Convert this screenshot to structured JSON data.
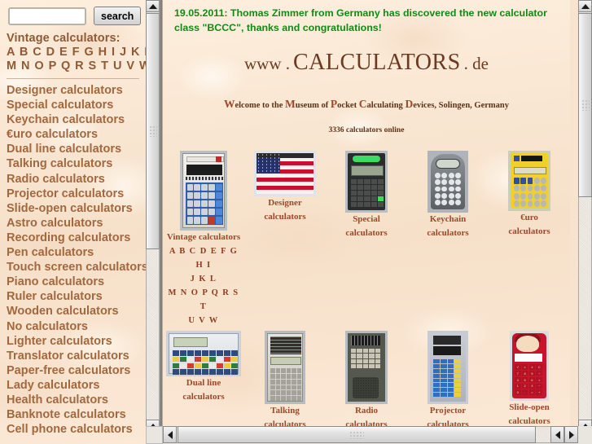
{
  "search": {
    "value": "",
    "placeholder": "",
    "button_label": "search"
  },
  "sidebar": {
    "heading": "Vintage calculators:",
    "alphabet_lines": [
      "A B C D E F G H I J K L",
      "M N O P Q R S T U V W"
    ],
    "items": [
      "Designer calculators",
      "Special calculators",
      "Keychain calculators",
      "€uro calculators",
      "Dual line calculators",
      "Talking calculators",
      "Radio calculators",
      "Projector calculators",
      "Slide-open calculators",
      "Astro calculators",
      "Recording calculators",
      "Pen calculators",
      "Touch screen calculators",
      "Piano calculators",
      "Ruler calculators",
      "Wooden calculators",
      "No calculators",
      "Lighter calculators",
      "Translator calculators",
      "Paper-free calculators",
      "Lady calculators",
      "Health calculators",
      "Banknote calculators",
      "Cell phone calculators"
    ]
  },
  "main": {
    "banner": "19.05.2011: Thomas Zimmer from Germany has discovered the new calculator class \"BCCC\", thanks and congratulations!",
    "banner_color": "#138a13",
    "title_prefix": "www .",
    "title_main": "CALCULATORS",
    "title_suffix": ". de",
    "subtitle_parts": [
      {
        "cap": "W",
        "rest": "elcome to the "
      },
      {
        "cap": "M",
        "rest": "useum of "
      },
      {
        "cap": "P",
        "rest": "ocket "
      },
      {
        "cap": "C",
        "rest": "alculating "
      },
      {
        "cap": "D",
        "rest": "evices, Solingen, Germany"
      }
    ],
    "counter": "3336 calculators online",
    "grid": [
      {
        "label_lines": [
          "Vintage calculators"
        ],
        "alpha_lines": [
          "A B C D E F G H I",
          "J K L",
          "M N O P Q R S T",
          "U V W"
        ],
        "art": "vintage"
      },
      {
        "label_lines": [
          "Designer",
          "calculators"
        ],
        "alpha_lines": [],
        "art": "flag"
      },
      {
        "label_lines": [
          "Special",
          "calculators"
        ],
        "alpha_lines": [],
        "art": "special"
      },
      {
        "label_lines": [
          "Keychain",
          "calculators"
        ],
        "alpha_lines": [],
        "art": "keychain"
      },
      {
        "label_lines": [
          "€uro",
          "calculators"
        ],
        "alpha_lines": [],
        "art": "euro"
      },
      {
        "label_lines": [
          "Dual line",
          "calculators"
        ],
        "alpha_lines": [],
        "art": "dual"
      },
      {
        "label_lines": [
          "Talking",
          "calculators"
        ],
        "alpha_lines": [],
        "art": "talking"
      },
      {
        "label_lines": [
          "Radio",
          "calculators"
        ],
        "alpha_lines": [],
        "art": "radio"
      },
      {
        "label_lines": [
          "Projector",
          "calculators"
        ],
        "alpha_lines": [],
        "art": "projector"
      },
      {
        "label_lines": [
          "Slide-open",
          "calculators"
        ],
        "alpha_lines": [],
        "art": "slide"
      }
    ]
  },
  "colors": {
    "page_background": "#fbe9d7",
    "sidebar_heading": "#8e5a37",
    "sidebar_link": "#a2683f",
    "caption": "#9c4a2a",
    "title": "#6b3a22",
    "banner": "#138a13"
  },
  "slide_keys": [
    "√",
    "×",
    "±",
    "C",
    "7",
    "8",
    "9",
    "÷",
    "4",
    "5",
    "6",
    "×",
    "1",
    "2",
    "3",
    "−",
    "0",
    ".",
    "=",
    "+"
  ]
}
